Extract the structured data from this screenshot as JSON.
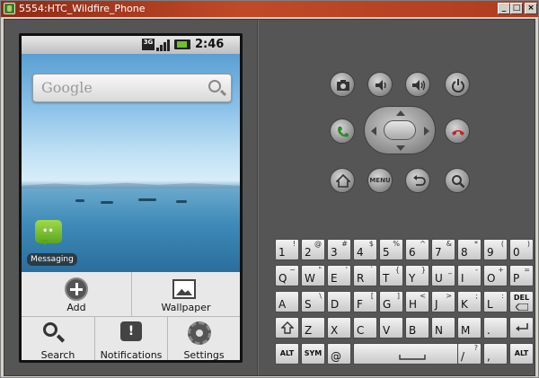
{
  "window": {
    "title": "5554:HTC_Wildfire_Phone",
    "buttons": {
      "minimize": "_",
      "maximize": "□",
      "close": "×"
    }
  },
  "status_bar": {
    "network": "3G",
    "time": "2:46 AM",
    "icons": [
      "3g-icon",
      "signal-icon",
      "battery-icon"
    ]
  },
  "search_widget": {
    "logo_text": "Google",
    "icon": "search-icon"
  },
  "home_app": {
    "label": "Messaging",
    "icon": "messaging-icon"
  },
  "options_menu": {
    "items": [
      {
        "label": "Add",
        "icon": "add-icon"
      },
      {
        "label": "Wallpaper",
        "icon": "wallpaper-icon"
      },
      {
        "label": "Search",
        "icon": "search-icon"
      },
      {
        "label": "Notifications",
        "icon": "notifications-icon"
      },
      {
        "label": "Settings",
        "icon": "settings-icon"
      }
    ]
  },
  "hardware_buttons": {
    "camera": "camera-icon",
    "volume_down": "volume-down-icon",
    "volume_up": "volume-up-icon",
    "power": "power-icon",
    "call": "call-icon",
    "end_call": "end-call-icon",
    "home": "home-icon",
    "menu_label": "MENU",
    "back": "back-icon",
    "search": "search-icon"
  },
  "keyboard": {
    "row1": [
      {
        "m": "1",
        "a": "!"
      },
      {
        "m": "2",
        "a": "@"
      },
      {
        "m": "3",
        "a": "#"
      },
      {
        "m": "4",
        "a": "$"
      },
      {
        "m": "5",
        "a": "%"
      },
      {
        "m": "6",
        "a": "^"
      },
      {
        "m": "7",
        "a": "&"
      },
      {
        "m": "8",
        "a": "*"
      },
      {
        "m": "9",
        "a": "("
      },
      {
        "m": "0",
        "a": ")"
      }
    ],
    "row2": [
      {
        "m": "Q",
        "a": "~"
      },
      {
        "m": "W",
        "a": "\""
      },
      {
        "m": "E",
        "a": "'"
      },
      {
        "m": "R",
        "a": "`"
      },
      {
        "m": "T",
        "a": "{"
      },
      {
        "m": "Y",
        "a": "}"
      },
      {
        "m": "U",
        "a": "_"
      },
      {
        "m": "I",
        "a": "-"
      },
      {
        "m": "O",
        "a": "+"
      },
      {
        "m": "P",
        "a": "="
      }
    ],
    "row3": [
      {
        "m": "A",
        "a": ""
      },
      {
        "m": "S",
        "a": "\\"
      },
      {
        "m": "D",
        "a": ""
      },
      {
        "m": "F",
        "a": "["
      },
      {
        "m": "G",
        "a": "]"
      },
      {
        "m": "H",
        "a": "<"
      },
      {
        "m": "J",
        "a": ">"
      },
      {
        "m": "K",
        "a": ";"
      },
      {
        "m": "L",
        "a": ":"
      }
    ],
    "del_label": "DEL",
    "row4": [
      {
        "m": "Z",
        "a": ""
      },
      {
        "m": "X",
        "a": ""
      },
      {
        "m": "C",
        "a": ""
      },
      {
        "m": "V",
        "a": ""
      },
      {
        "m": "B",
        "a": ""
      },
      {
        "m": "N",
        "a": ""
      },
      {
        "m": "M",
        "a": ""
      },
      {
        "m": ".",
        "a": ""
      }
    ],
    "row5": [
      {
        "m": "ALT"
      },
      {
        "m": "SYM"
      },
      {
        "m": "@"
      },
      {
        "m": ""
      },
      {
        "m": "/",
        "a": "?"
      },
      {
        "m": ",",
        "a": ""
      },
      {
        "m": "ALT"
      }
    ]
  }
}
